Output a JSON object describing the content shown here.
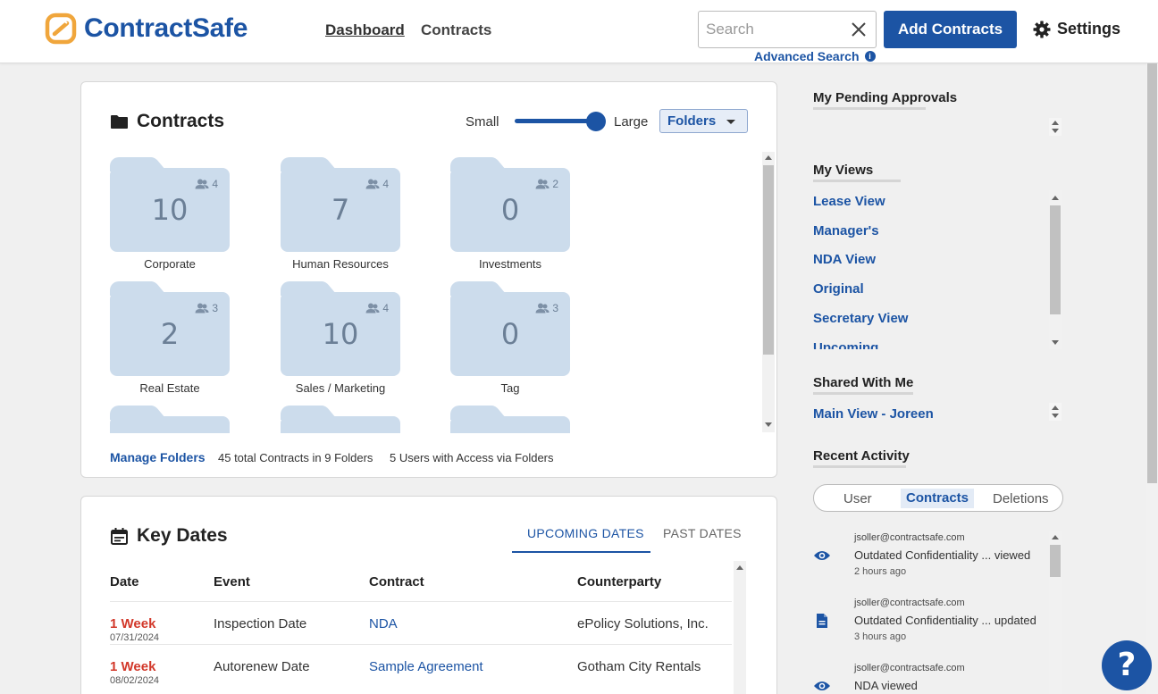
{
  "header": {
    "brand": "ContractSafe",
    "nav": [
      {
        "label": "Dashboard"
      },
      {
        "label": "Contracts"
      }
    ],
    "search_placeholder": "Search",
    "advanced_search": "Advanced Search",
    "add_contracts": "Add Contracts",
    "settings": "Settings",
    "brand_color": "#1c54a4",
    "logo_color": "#f0a63c"
  },
  "contracts_card": {
    "title": "Contracts",
    "size_small": "Small",
    "size_large": "Large",
    "view_select": "Folders",
    "folders": [
      {
        "name": "Corporate",
        "count": "10",
        "users": "4"
      },
      {
        "name": "Human Resources",
        "count": "7",
        "users": "4"
      },
      {
        "name": "Investments",
        "count": "0",
        "users": "2"
      },
      {
        "name": "Real Estate",
        "count": "2",
        "users": "3"
      },
      {
        "name": "Sales / Marketing",
        "count": "10",
        "users": "4"
      },
      {
        "name": "Tag",
        "count": "0",
        "users": "3"
      }
    ],
    "manage_folders": "Manage Folders",
    "total_stat": "45 total Contracts in 9 Folders",
    "users_stat": "5 Users with Access via Folders"
  },
  "key_dates": {
    "title": "Key Dates",
    "tabs": [
      "UPCOMING DATES",
      "PAST DATES"
    ],
    "columns": [
      "Date",
      "Event",
      "Contract",
      "Counterparty"
    ],
    "rows": [
      {
        "when": "1 Week",
        "date": "07/31/2024",
        "event": "Inspection Date",
        "contract": "NDA",
        "counterparty": "ePolicy Solutions, Inc."
      },
      {
        "when": "1 Week",
        "date": "08/02/2024",
        "event": "Autorenew Date",
        "contract": "Sample Agreement",
        "counterparty": "Gotham City Rentals"
      }
    ]
  },
  "sidebar": {
    "pending_title": "My Pending Approvals",
    "views_title": "My Views",
    "views": [
      "Lease View",
      "Manager's",
      "NDA View",
      "Original",
      "Secretary View",
      "Upcoming"
    ],
    "shared_title": "Shared With Me",
    "shared": [
      "Main View - Joreen"
    ],
    "recent_title": "Recent Activity",
    "recent_tabs": [
      "User",
      "Contracts",
      "Deletions"
    ],
    "activity": [
      {
        "email": "jsoller@contractsafe.com",
        "text": "Outdated Confidentiality ... viewed",
        "time": "2 hours ago",
        "icon": "eye-icon"
      },
      {
        "email": "jsoller@contractsafe.com",
        "text": "Outdated Confidentiality ... updated",
        "time": "3 hours ago",
        "icon": "document-icon"
      },
      {
        "email": "jsoller@contractsafe.com",
        "text": "NDA viewed",
        "time": "",
        "icon": "eye-icon"
      }
    ]
  },
  "help": "?"
}
